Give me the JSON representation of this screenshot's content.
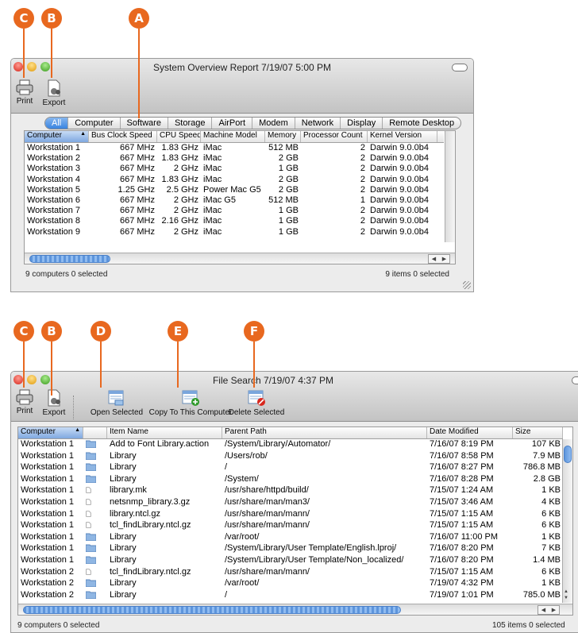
{
  "callouts": {
    "a": "A",
    "b": "B",
    "c": "C",
    "d": "D",
    "e": "E",
    "f": "F"
  },
  "win1": {
    "title": "System Overview Report  7/19/07 5:00 PM",
    "print_label": "Print",
    "export_label": "Export",
    "tabs": [
      "All",
      "Computer",
      "Software",
      "Storage",
      "AirPort",
      "Modem",
      "Network",
      "Display",
      "Remote Desktop"
    ],
    "active_tab": "All",
    "columns": [
      "Computer",
      "Bus Clock Speed",
      "CPU Speed",
      "Machine Model",
      "Memory",
      "Processor Count",
      "Kernel Version"
    ],
    "rows": [
      [
        "Workstation 1",
        "667 MHz",
        "1.83 GHz",
        "iMac",
        "512 MB",
        "2",
        "Darwin 9.0.0b4"
      ],
      [
        "Workstation 2",
        "667 MHz",
        "1.83 GHz",
        "iMac",
        "2 GB",
        "2",
        "Darwin 9.0.0b4"
      ],
      [
        "Workstation 3",
        "667 MHz",
        "2 GHz",
        "iMac",
        "1 GB",
        "2",
        "Darwin 9.0.0b4"
      ],
      [
        "Workstation 4",
        "667 MHz",
        "1.83 GHz",
        "iMac",
        "2 GB",
        "2",
        "Darwin 9.0.0b4"
      ],
      [
        "Workstation 5",
        "1.25 GHz",
        "2.5 GHz",
        "Power Mac G5",
        "2 GB",
        "2",
        "Darwin 9.0.0b4"
      ],
      [
        "Workstation 6",
        "667 MHz",
        "2 GHz",
        "iMac G5",
        "512 MB",
        "1",
        "Darwin 9.0.0b4"
      ],
      [
        "Workstation 7",
        "667 MHz",
        "2 GHz",
        "iMac",
        "1 GB",
        "2",
        "Darwin 9.0.0b4"
      ],
      [
        "Workstation 8",
        "667 MHz",
        "2.16 GHz",
        "iMac",
        "1 GB",
        "2",
        "Darwin 9.0.0b4"
      ],
      [
        "Workstation 9",
        "667 MHz",
        "2 GHz",
        "iMac",
        "1 GB",
        "2",
        "Darwin 9.0.0b4"
      ]
    ],
    "status_left": "9 computers   0 selected",
    "status_right": "9 items   0 selected"
  },
  "win2": {
    "title": "File Search  7/19/07 4:37 PM",
    "print_label": "Print",
    "export_label": "Export",
    "open_label": "Open Selected",
    "copy_label": "Copy To This Computer",
    "delete_label": "Delete Selected",
    "columns": [
      "Computer",
      "",
      "Item Name",
      "Parent Path",
      "Date Modified",
      "Size"
    ],
    "rows": [
      [
        "Workstation 1",
        "folder",
        "Add to Font Library.action",
        "/System/Library/Automator/",
        "7/16/07 8:19 PM",
        "107 KB"
      ],
      [
        "Workstation 1",
        "folder",
        "Library",
        "/Users/rob/",
        "7/16/07 8:58 PM",
        "7.9 MB"
      ],
      [
        "Workstation 1",
        "folder",
        "Library",
        "/",
        "7/16/07 8:27 PM",
        "786.8 MB"
      ],
      [
        "Workstation 1",
        "folder",
        "Library",
        "/System/",
        "7/16/07 8:28 PM",
        "2.8 GB"
      ],
      [
        "Workstation 1",
        "file",
        "library.mk",
        "/usr/share/httpd/build/",
        "7/15/07 1:24 AM",
        "1 KB"
      ],
      [
        "Workstation 1",
        "file",
        "netsnmp_library.3.gz",
        "/usr/share/man/man3/",
        "7/15/07 3:46 AM",
        "4 KB"
      ],
      [
        "Workstation 1",
        "file",
        "library.ntcl.gz",
        "/usr/share/man/mann/",
        "7/15/07 1:15 AM",
        "6 KB"
      ],
      [
        "Workstation 1",
        "file",
        "tcl_findLibrary.ntcl.gz",
        "/usr/share/man/mann/",
        "7/15/07 1:15 AM",
        "6 KB"
      ],
      [
        "Workstation 1",
        "folder",
        "Library",
        "/var/root/",
        "7/16/07 11:00 PM",
        "1 KB"
      ],
      [
        "Workstation 1",
        "folder",
        "Library",
        "/System/Library/User Template/English.lproj/",
        "7/16/07 8:20 PM",
        "7 KB"
      ],
      [
        "Workstation 1",
        "folder",
        "Library",
        "/System/Library/User Template/Non_localized/",
        "7/16/07 8:20 PM",
        "1.4 MB"
      ],
      [
        "Workstation 2",
        "file",
        "tcl_findLibrary.ntcl.gz",
        "/usr/share/man/mann/",
        "7/15/07 1:15 AM",
        "6 KB"
      ],
      [
        "Workstation 2",
        "folder",
        "Library",
        "/var/root/",
        "7/19/07 4:32 PM",
        "1 KB"
      ],
      [
        "Workstation 2",
        "folder",
        "Library",
        "/",
        "7/19/07 1:01 PM",
        "785.0 MB"
      ]
    ],
    "status_left": "9 computers   0 selected",
    "status_right": "105 items   0 selected"
  },
  "icons": {
    "print": "printer-icon",
    "export": "export-icon",
    "open": "open-selected-icon",
    "copy": "copy-to-computer-icon",
    "delete": "delete-selected-icon",
    "folder": "folder-icon",
    "file": "document-icon",
    "sort": "sort-ascending-icon"
  },
  "colors": {
    "callout": "#e8681f",
    "selection": "#3a84e0",
    "delete_badge": "#d8281e",
    "add_badge": "#2f9a2a"
  }
}
